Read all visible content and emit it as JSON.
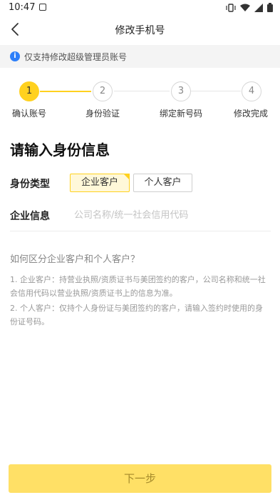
{
  "status_bar": {
    "time": "10:47"
  },
  "nav": {
    "title": "修改手机号"
  },
  "notice": {
    "icon_char": "i",
    "text": "仅支持修改超级管理员账号"
  },
  "steps": [
    {
      "number": "1",
      "label": "确认账号",
      "active": true
    },
    {
      "number": "2",
      "label": "身份验证",
      "active": false
    },
    {
      "number": "3",
      "label": "绑定新号码",
      "active": false
    },
    {
      "number": "4",
      "label": "修改完成",
      "active": false
    }
  ],
  "form": {
    "title": "请输入身份信息",
    "identity_type_label": "身份类型",
    "type_enterprise": "企业客户",
    "type_personal": "个人客户",
    "selected_type": "企业客户",
    "company_label": "企业信息",
    "company_placeholder": "公司名称/统一社会信用代码",
    "company_value": ""
  },
  "help": {
    "title": "如何区分企业客户和个人客户？",
    "item1": "1. 企业客户：持营业执照/资质证书与美团签约的客户，公司名称和统一社会信用代码以营业执照/资质证书上的信息为准。",
    "item2": "2. 个人客户：仅持个人身份证与美团签约的客户，请输入签约时使用的身份证号码。"
  },
  "next_button": {
    "label": "下一步"
  },
  "colors": {
    "accent": "#ffd11f",
    "button_bg": "#ffe066",
    "info_blue": "#2d7ff9"
  }
}
